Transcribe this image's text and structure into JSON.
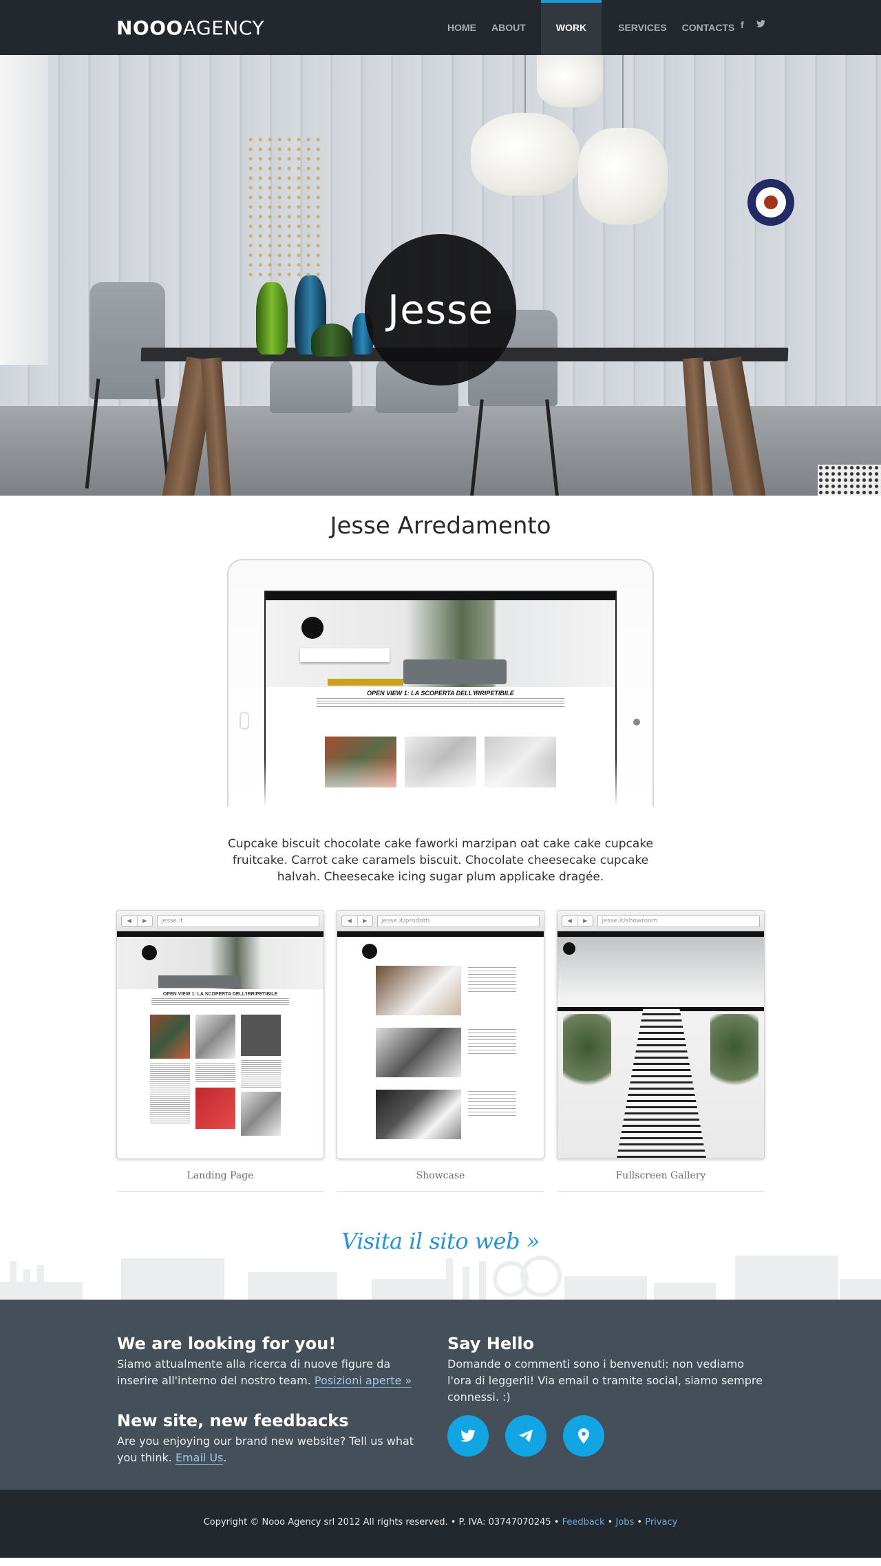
{
  "nav": {
    "logo_bold": "NOOO",
    "logo_light": "AGENCY",
    "items": [
      {
        "label": "HOME",
        "active": false
      },
      {
        "label": "ABOUT",
        "active": false
      },
      {
        "label": "WORK",
        "active": true
      },
      {
        "label": "SERVICES",
        "active": false
      },
      {
        "label": "CONTACTS",
        "active": false
      }
    ],
    "social": [
      {
        "icon": "facebook-icon",
        "glyph": "f"
      },
      {
        "icon": "twitter-icon",
        "glyph": "🐦"
      }
    ],
    "active_color": "#1a9ad6"
  },
  "hero": {
    "badge_text": "Jesse"
  },
  "project": {
    "title": "Jesse Arredamento",
    "description": "Cupcake biscuit chocolate cake faworki marzipan oat cake cake cupcake fruitcake. Carrot cake caramels biscuit. Chocolate cheesecake cupcake halvah. Cheesecake icing sugar plum applicake dragée.",
    "ipad_page_heading": "OPEN VIEW 1: LA SCOPERTA DELL'IRRIPETIBILE"
  },
  "screenshots": [
    {
      "url": "jesse.it",
      "caption": "Landing Page"
    },
    {
      "url": "jesse.it/prodotti",
      "caption": "Showcase"
    },
    {
      "url": "jesse.it/showroom",
      "caption": "Fullscreen Gallery"
    }
  ],
  "browser_buttons": {
    "back": "◀",
    "forward": "▶"
  },
  "visit_link": "Visita il sito web »",
  "footer": {
    "col1": {
      "title1": "We are looking for you!",
      "text1": "Siamo attualmente alla ricerca di nuove figure da inserire all'interno del nostro team.",
      "link1": "Posizioni aperte »",
      "title2": "New site, new feedbacks",
      "text2": "Are you enjoying our brand new website? Tell us what you think.",
      "link2": "Email Us",
      "text2_end": "."
    },
    "col2": {
      "title": "Say Hello",
      "text": "Domande o commenti sono i benvenuti: non vediamo l'ora di leggerli! Via email o tramite social, siamo sempre connessi. :)",
      "icons": [
        "twitter-icon",
        "send-icon",
        "location-pin-icon"
      ]
    },
    "accent_color": "#12a5e4"
  },
  "bottom": {
    "copyright": "Copyright © Nooo Agency srl 2012 All rights reserved. • P. IVA: 03747070245 •",
    "links": [
      "Feedback",
      "Jobs",
      "Privacy"
    ],
    "separator": "•"
  }
}
